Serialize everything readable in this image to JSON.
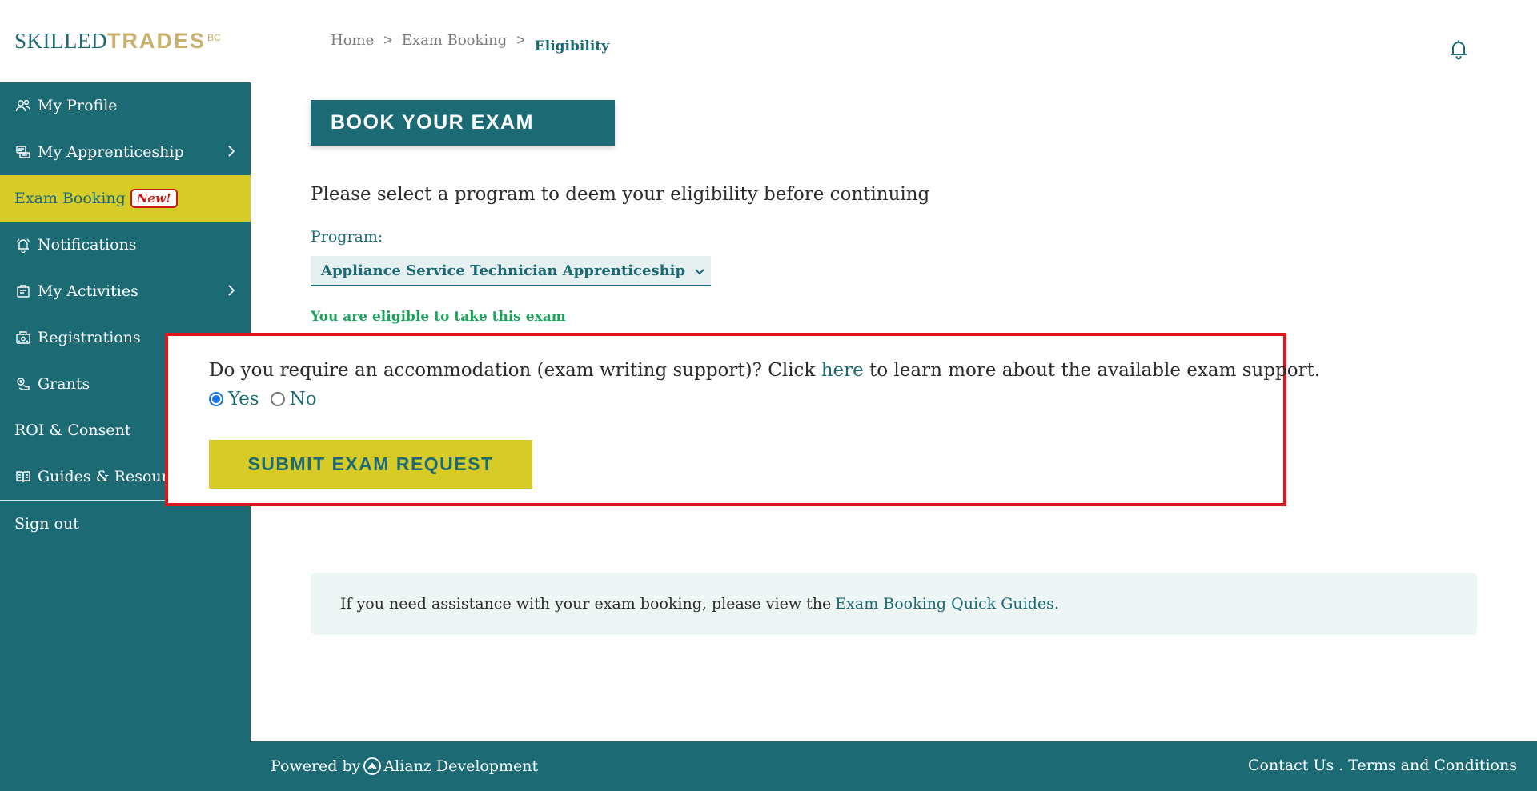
{
  "brand": {
    "part1": "SKILLED",
    "part2": "TRADES",
    "suffix": "BC"
  },
  "breadcrumb": {
    "home": "Home",
    "sep1": ">",
    "exam_booking": "Exam Booking",
    "sep2": ">",
    "current": "Eligibility"
  },
  "sidebar": {
    "items": [
      {
        "label": "My Profile",
        "icon": "users-icon"
      },
      {
        "label": "My Apprenticeship",
        "icon": "apprenticeship-icon"
      },
      {
        "label": "Exam Booking",
        "badge": "New!"
      },
      {
        "label": "Notifications",
        "icon": "bell-icon"
      },
      {
        "label": "My Activities",
        "icon": "activities-icon"
      },
      {
        "label": "Registrations",
        "icon": "registrations-icon"
      },
      {
        "label": "Grants",
        "icon": "grants-icon"
      },
      {
        "label": "ROI & Consent"
      },
      {
        "label": "Guides & Resources",
        "icon": "book-icon"
      },
      {
        "label": "Sign out"
      }
    ]
  },
  "main": {
    "title": "BOOK YOUR EXAM",
    "prompt": "Please select a program to deem your eligibility before continuing",
    "program_label": "Program:",
    "program_selected": "Appliance Service Technician Apprenticeship",
    "eligibility_status": "You are eligible to take this exam",
    "accommodation": {
      "question_before": "Do you require an accommodation (exam writing support)? Click",
      "link": "here",
      "question_after": "to learn more about the available exam support.",
      "option_yes": "Yes",
      "option_no": "No",
      "selected": "Yes"
    },
    "submit_label": "SUBMIT EXAM REQUEST",
    "assist_text": "If you need assistance with your exam booking, please view the",
    "assist_link": "Exam Booking Quick Guides."
  },
  "footer": {
    "powered_by": "Powered by",
    "company": "Alianz Development",
    "contact": "Contact Us",
    "separator": ".",
    "terms": "Terms and Conditions"
  },
  "colors": {
    "teal": "#1b6a74",
    "yellow": "#d7cb28",
    "gold": "#c9b06b",
    "success": "#1aa35a",
    "highlight_border": "#e0161b",
    "badge_red": "#c91a1a",
    "assist_bg": "#eef6f5"
  }
}
